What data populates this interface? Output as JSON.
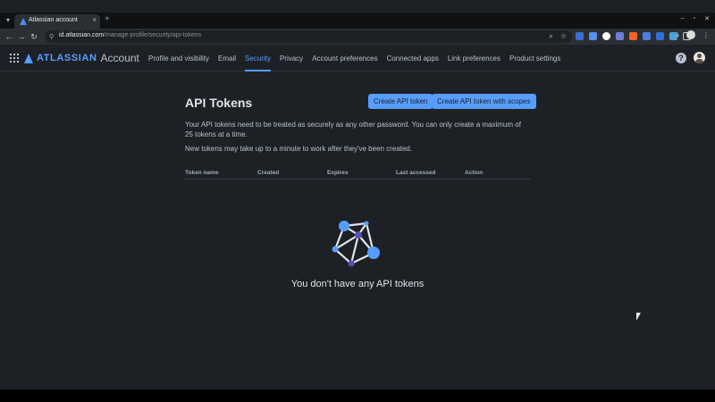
{
  "browser": {
    "tab_title": "Atlassian account",
    "tab_close": "×",
    "new_tab": "+",
    "url_host": "id.atlassian.com",
    "url_path": "/manage-profile/security/api-tokens",
    "window_controls": [
      "–",
      "▫",
      "✕"
    ]
  },
  "header": {
    "logo_word": "ATLASSIAN",
    "logo_product": "Account",
    "nav": [
      {
        "label": "Profile and visibility"
      },
      {
        "label": "Email"
      },
      {
        "label": "Security"
      },
      {
        "label": "Privacy"
      },
      {
        "label": "Account preferences"
      },
      {
        "label": "Connected apps"
      },
      {
        "label": "Link preferences"
      },
      {
        "label": "Product settings"
      }
    ],
    "active_nav": "Security",
    "help": "?"
  },
  "page": {
    "title": "API Tokens",
    "create_button": "Create API token",
    "create_scopes_button": "Create API token with scopes",
    "description": "Your API tokens need to be treated as securely as any other password. You can only create a maximum of 25 tokens at a time.",
    "description2": "New tokens may take up to a minute to work after they've been created.",
    "columns": [
      "Token name",
      "Created",
      "Expires",
      "Last accessed",
      "Action"
    ],
    "empty_message": "You don't have any API tokens"
  },
  "colors": {
    "accent": "#579dff",
    "background": "#1d2125",
    "text": "#b6c2cf"
  }
}
